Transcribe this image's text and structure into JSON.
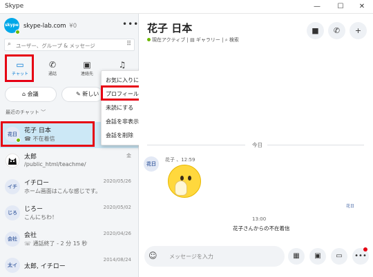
{
  "window": {
    "title": "Skype",
    "minimize": "—",
    "maximize": "☐",
    "close": "✕"
  },
  "profile": {
    "avatar_text": "skype",
    "name": "skype-lab.com",
    "credit": "¥0"
  },
  "search": {
    "placeholder": "ユーザー、グループ & メッセージ"
  },
  "tabs": [
    {
      "label": "チャット",
      "icon": "chat-icon"
    },
    {
      "label": "通話",
      "icon": "phone-icon"
    },
    {
      "label": "連絡先",
      "icon": "contacts-icon"
    },
    {
      "label": "通知",
      "icon": "bell-icon"
    }
  ],
  "actions": {
    "meet": "会議",
    "new_chat": "新しい"
  },
  "section_label": "最近のチャット ﹀",
  "chats": [
    {
      "avatar": "花日",
      "name": "花子 日本",
      "preview": "不在着信",
      "date": ""
    },
    {
      "avatar": "",
      "name": "太郎",
      "preview": "/public_html/teachme/",
      "date": "金"
    },
    {
      "avatar": "イチ",
      "name": "イチロー",
      "preview": "ホーム画面はこんな感じです。",
      "date": "2020/05/26"
    },
    {
      "avatar": "じろ",
      "name": "じろー",
      "preview": "こんにちわ！",
      "date": "2020/05/02"
    },
    {
      "avatar": "会社",
      "name": "会社",
      "preview": "通話終了 - 2 分 15 秒",
      "date": "2020/04/26"
    },
    {
      "avatar": "太イ",
      "name": "太郎, イチロー",
      "preview": "",
      "date": "2014/08/24"
    }
  ],
  "context_menu": {
    "items": [
      "お気に入りに追加",
      "プロフィールを表示",
      "未読にする",
      "会話を非表示",
      "会話を削除"
    ]
  },
  "conversation": {
    "title": "花子 日本",
    "status": "現在アクティブ",
    "gallery": "ギャラリー",
    "search": "検索",
    "day_divider": "今日",
    "msg_avatar": "花日",
    "msg_meta": "花子 、12:59",
    "seen_avatar": "花日",
    "call_time": "13:00",
    "call_text": "花子さんからの不在着信",
    "composer_placeholder": "メッセージを入力"
  },
  "colors": {
    "accent": "#0078d4",
    "highlight": "#e60012",
    "selected": "#cce8f6",
    "presence": "#6bb700"
  }
}
